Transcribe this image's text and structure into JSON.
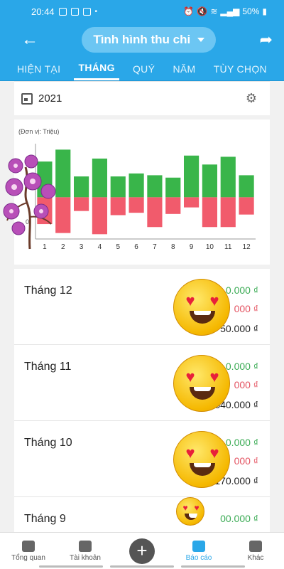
{
  "status": {
    "time": "20:44",
    "battery": "50%"
  },
  "appbar": {
    "title": "Tình hình thu chi"
  },
  "tabs": [
    "HIỆN TẠI",
    "THÁNG",
    "QUÝ",
    "NĂM",
    "TÙY CHỌN"
  ],
  "active_tab": "THÁNG",
  "year": "2021",
  "unit_label": "(Đơn vị: Triệu)",
  "chart_data": {
    "type": "bar",
    "categories": [
      "1",
      "2",
      "3",
      "4",
      "5",
      "6",
      "7",
      "8",
      "9",
      "10",
      "11",
      "12"
    ],
    "series": [
      {
        "values": [
          6,
          8,
          3.5,
          6.5,
          3.5,
          4,
          3.7,
          3.3,
          7,
          5.5,
          6.8,
          3.7
        ]
      },
      {
        "values": [
          -4.5,
          -6,
          -2.3,
          -6.2,
          -3,
          -2.6,
          -5,
          -2.8,
          -1.7,
          -5,
          -5,
          -2.9
        ]
      }
    ],
    "colors": {
      "income": "#39b54a",
      "expense": "#f15b6c"
    },
    "ylabel": "0"
  },
  "months": [
    {
      "label": "Tháng 12",
      "income": "0.000 ₫",
      "expense": "000 ₫",
      "net": "50.000 ₫"
    },
    {
      "label": "Tháng 11",
      "income": "0.000 ₫",
      "expense": "000 ₫",
      "net": "540.000 ₫"
    },
    {
      "label": "Tháng 10",
      "income": "0.000 ₫",
      "expense": "000 ₫",
      "net": "170.000 ₫"
    },
    {
      "label": "Tháng 9",
      "income": "00.000 ₫",
      "expense": "",
      "net": ""
    }
  ],
  "nav": [
    {
      "label": "Tổng quan"
    },
    {
      "label": "Tài khoản"
    },
    {
      "label": "+"
    },
    {
      "label": "Báo cáo"
    },
    {
      "label": "Khác"
    }
  ]
}
